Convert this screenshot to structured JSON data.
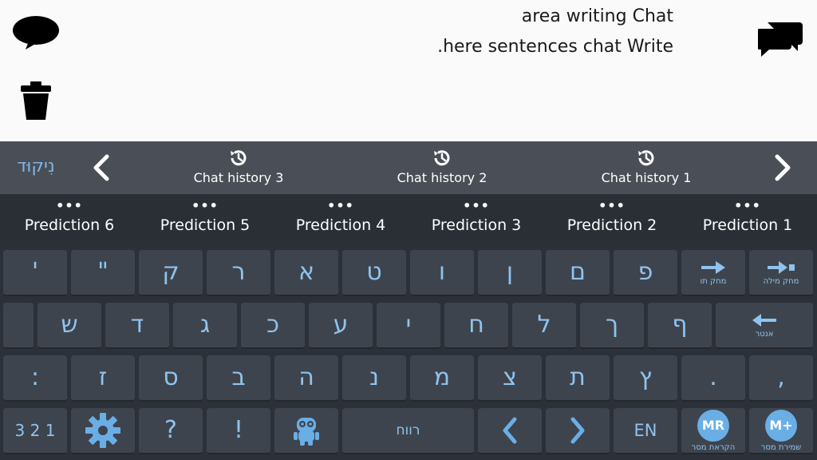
{
  "chat": {
    "line1": "area writing Chat",
    "line2": ".here sentences chat Write"
  },
  "icons": {
    "speech": "speech-bubble-icon",
    "trash": "trash-icon",
    "chat": "chat-bubbles-icon",
    "history": "history-clock-icon",
    "settings": "gear-icon",
    "robot": "robot-icon"
  },
  "history_bar": {
    "niqqud_label": "נִיקוּד",
    "items": [
      "Chat history 3",
      "Chat history 2",
      "Chat history 1"
    ]
  },
  "predictions": {
    "dots": "•••",
    "items": [
      "Prediction 6",
      "Prediction 5",
      "Prediction 4",
      "Prediction 3",
      "Prediction 2",
      "Prediction 1"
    ]
  },
  "keyboard": {
    "row1": [
      "'",
      "\"",
      "ק",
      "ר",
      "א",
      "ט",
      "ו",
      "ן",
      "ם",
      "פ"
    ],
    "delete_word_label": "מחק מילה",
    "delete_char_label": "מחק תו",
    "row2": [
      "ש",
      "ד",
      "ג",
      "כ",
      "ע",
      "י",
      "ח",
      "ל",
      "ך",
      "ף"
    ],
    "enter_label": "אנטר",
    "row3": [
      ":",
      "ז",
      "ס",
      "ב",
      "ה",
      "נ",
      "מ",
      "צ",
      "ת",
      "ץ",
      ".",
      ","
    ],
    "row4": {
      "numbers_label": "3 2 1",
      "question": "?",
      "exclaim": "!",
      "space_label": "רווח",
      "lang_label": "EN",
      "mr_badge": "MR",
      "mr_label": "הקראת מסר",
      "mplus_badge": "M+",
      "mplus_label": "שמירת מסר"
    }
  },
  "colors": {
    "accent": "#8fc3ee",
    "key_bg": "#3e444d",
    "history_bg": "#4a4f57",
    "badge": "#6aaee6"
  }
}
